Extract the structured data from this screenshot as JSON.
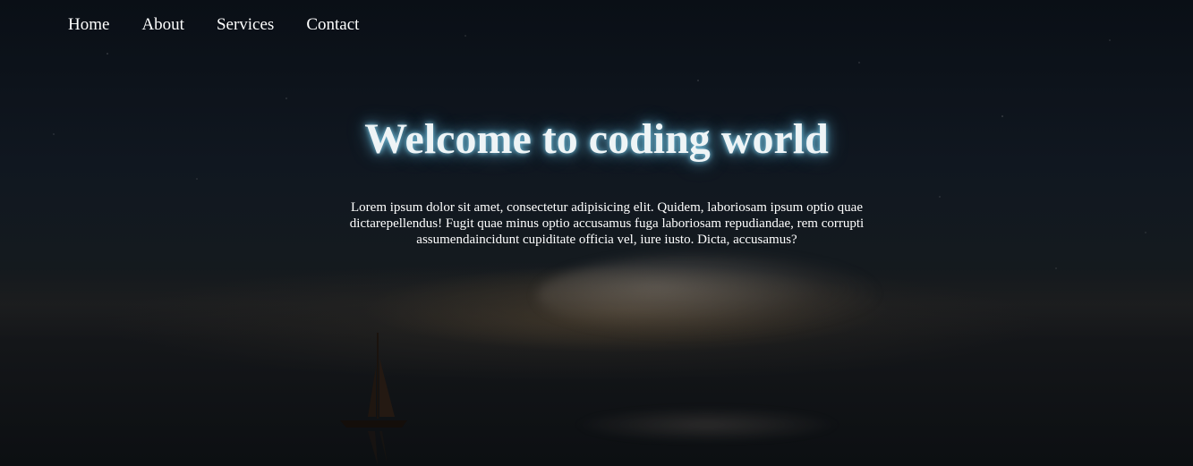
{
  "nav": {
    "items": [
      {
        "label": "Home"
      },
      {
        "label": "About"
      },
      {
        "label": "Services"
      },
      {
        "label": "Contact"
      }
    ]
  },
  "hero": {
    "title": "Welcome to coding world",
    "description": "Lorem ipsum dolor sit amet, consectetur adipisicing elit. Quidem, laboriosam ipsum optio quae dictarepellendus! Fugit quae minus optio accusamus fuga laboriosam repudiandae, rem corrupti assumendaincidunt cupiditate officia vel, iure iusto. Dicta, accusamus?"
  },
  "colors": {
    "text": "#ffffff",
    "title_glow": "#7fd3f0",
    "background": "#0b1016"
  }
}
